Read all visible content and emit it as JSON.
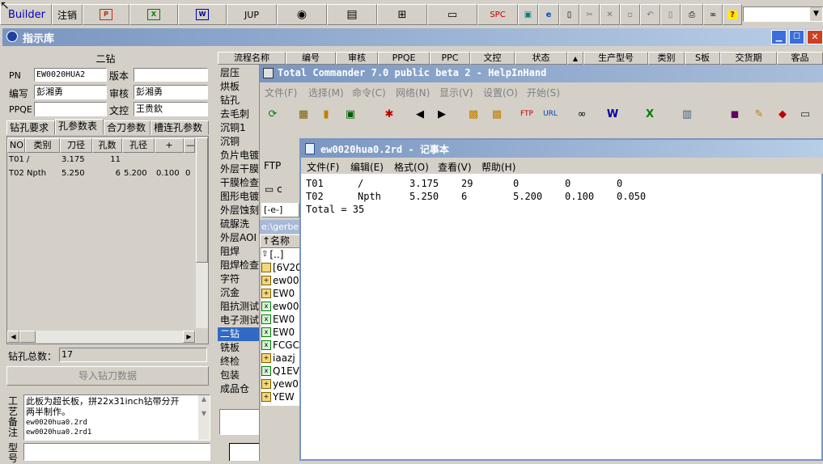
{
  "toolbar": {
    "builder_label": "Builder",
    "cancel_label": "注销",
    "jup_label": "JUP",
    "spc_label": "SPC"
  },
  "main_window": {
    "title": "指示库"
  },
  "form": {
    "header": "二钻",
    "pn_label": "PN",
    "pn_value": "EW0020HUA2",
    "version_label": "版本",
    "version_value": "",
    "editor_label": "编写",
    "editor_value": "彭湘勇",
    "reviewer_label": "审核",
    "reviewer_value": "彭湘勇",
    "ppqe_label": "PPQE",
    "ppqe_value": "",
    "doc_control_label": "文控",
    "doc_control_value": "王贵欽"
  },
  "tabs": [
    "钻孔要求",
    "孔参数表",
    "合刀参数",
    "槽连孔参数"
  ],
  "drill_table": {
    "headers": [
      "NO",
      "类别",
      "刀径",
      "孔数",
      "孔径",
      "+",
      "—"
    ],
    "rows": [
      [
        "T01",
        "/",
        "3.175",
        "11",
        "",
        "",
        ""
      ],
      [
        "T02",
        "Npth",
        "5.250",
        "6",
        "5.200",
        "0.100",
        "0"
      ]
    ]
  },
  "drill_total": {
    "label": "钻孔总数：",
    "value": "17"
  },
  "import_button": "导入钻刀数据",
  "process_note": {
    "label": "工艺备注",
    "text": "此板为超长板，拼22x31inch钻带分开两半制作。",
    "files": [
      "ew0020hua0.2rd",
      "ew0020hua0.2rd1"
    ]
  },
  "type_label": "型号",
  "process_list": [
    "层压",
    "烘板",
    "钻孔",
    "去毛刺",
    "沉铜1",
    "沉铜",
    "负片电镀",
    "外层干膜",
    "干膜检查",
    "图形电镀",
    "外层蚀刻",
    "硫脲洗",
    "外层AOI",
    "阻焊",
    "阻焊检查",
    "字符",
    "沉金",
    "阻抗测试",
    "电子测试",
    "二钻",
    "铣板",
    "终检",
    "包装",
    "成品仓"
  ],
  "process_selected": "二钻",
  "columns": [
    "流程名称",
    "编号",
    "审核",
    "PPQE",
    "PPC",
    "文控",
    "状态",
    "",
    "生产型号",
    "类别",
    "S板",
    "交货期",
    "客品"
  ],
  "tc_window": {
    "title": "Total Commander 7.0 public beta 2 - HelpInHand",
    "menu": [
      "文件(F)",
      "选择(M)",
      "命令(C)",
      "网络(N)",
      "显示(V)",
      "设置(O)",
      "开始(S)"
    ],
    "ftp_label": "FTP",
    "drive_label": "c",
    "drive_selector": "[-e-]",
    "path": "e:\\gerbe",
    "name_header": "↑名称",
    "files": [
      "[..]",
      "[6V20",
      "ew00",
      "EW0",
      "ew00",
      "EW0",
      "EW0",
      "FCGC",
      "iaazj",
      "Q1EV",
      "yew0",
      "YEW"
    ]
  },
  "notepad": {
    "title": "ew0020hua0.2rd - 记事本",
    "menu": [
      "文件(F)",
      "编辑(E)",
      "格式(O)",
      "查看(V)",
      "帮助(H)"
    ],
    "lines": [
      [
        "T01",
        "/",
        "3.175",
        "29",
        "0",
        "0",
        "0"
      ],
      [
        "T02",
        "Npth",
        "5.250",
        "6",
        "5.200",
        "0.100",
        "0.050"
      ]
    ],
    "total": "Total = 35"
  }
}
